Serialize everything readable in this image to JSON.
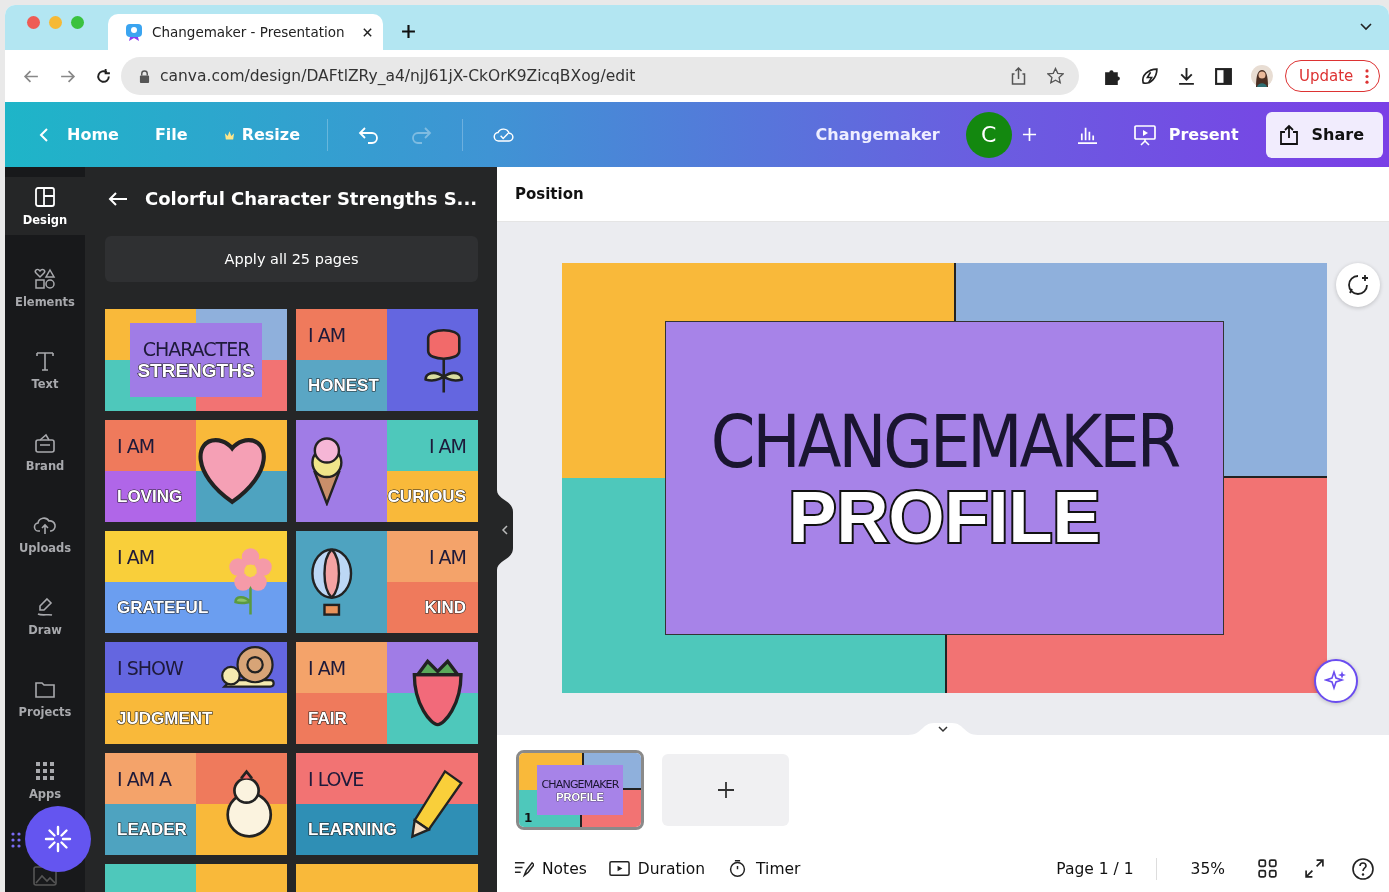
{
  "browser": {
    "tab_title": "Changemaker - Presentation",
    "url": "canva.com/design/DAFtlZRy_a4/njJ61jX-CkOrK9ZicqBXog/edit",
    "update_button": "Update"
  },
  "toolbar": {
    "home": "Home",
    "file": "File",
    "resize": "Resize",
    "redo_disabled": true,
    "design_title": "Changemaker",
    "avatar_letter": "C",
    "present": "Present",
    "share": "Share"
  },
  "rail": [
    {
      "label": "Design",
      "selected": true
    },
    {
      "label": "Elements",
      "selected": false
    },
    {
      "label": "Text",
      "selected": false
    },
    {
      "label": "Brand",
      "selected": false
    },
    {
      "label": "Uploads",
      "selected": false
    },
    {
      "label": "Draw",
      "selected": false
    },
    {
      "label": "Projects",
      "selected": false
    },
    {
      "label": "Apps",
      "selected": false
    }
  ],
  "panel": {
    "title": "Colorful Character Strengths S...",
    "apply_button": "Apply all 25 pages",
    "templates": [
      {
        "kind": "cover",
        "top": "CHARACTER",
        "bottom": "STRENGTHS"
      },
      {
        "kind": "card",
        "top": "I AM",
        "bottom": "HONEST"
      },
      {
        "kind": "card",
        "top": "I AM",
        "bottom": "LOVING"
      },
      {
        "kind": "card",
        "top": "I AM",
        "bottom": "CURIOUS"
      },
      {
        "kind": "card",
        "top": "I AM",
        "bottom": "GRATEFUL"
      },
      {
        "kind": "card",
        "top": "I AM",
        "bottom": "KIND"
      },
      {
        "kind": "card",
        "top": "I SHOW",
        "bottom": "JUDGMENT"
      },
      {
        "kind": "card",
        "top": "I AM",
        "bottom": "FAIR"
      },
      {
        "kind": "card",
        "top": "I AM A",
        "bottom": "LEADER"
      },
      {
        "kind": "card",
        "top": "I LOVE",
        "bottom": "LEARNING"
      },
      {
        "kind": "partial"
      },
      {
        "kind": "partial"
      }
    ]
  },
  "editor": {
    "position_button": "Position",
    "slide": {
      "title": "CHANGEMAKER",
      "subtitle": "PROFILE"
    },
    "pages": [
      {
        "number": "1",
        "title": "CHANGEMAKER",
        "subtitle": "PROFILE",
        "selected": true
      }
    ]
  },
  "bottom_bar": {
    "notes": "Notes",
    "duration": "Duration",
    "timer": "Timer",
    "page": "Page 1 / 1",
    "zoom": "35%"
  }
}
